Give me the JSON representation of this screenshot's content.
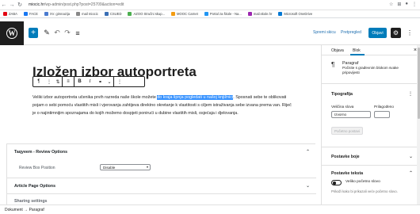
{
  "browser": {
    "url_host": "miocic.hr",
    "url_path": "/wp-admin/post.php?post=25709&action=edit",
    "bookmarks": [
      {
        "label": "ZABA",
        "color": "#e30613"
      },
      {
        "label": "FACE",
        "color": "#1877f2"
      },
      {
        "label": "XV. gimnazija",
        "color": "#4a7bd0"
      },
      {
        "label": "mail miocic",
        "color": "#888888"
      },
      {
        "label": "CSUED",
        "color": "#3a6fb5"
      },
      {
        "label": "AZOO Stručni skup...",
        "color": "#4caf50"
      },
      {
        "label": "MOOC Carnet",
        "color": "#f39c12"
      },
      {
        "label": "Portal za škole - Na...",
        "color": "#2196f3"
      },
      {
        "label": "mail.skole.hr",
        "color": "#9c27b0"
      },
      {
        "label": "Microsoft OneDrive",
        "color": "#0078d4"
      }
    ]
  },
  "topbar": {
    "save_draft": "Spremi skicu",
    "preview": "Pretpregled",
    "publish": "Objavi"
  },
  "editor": {
    "title": "Izložen izbor autoportreta",
    "paragraph_before": "Veliki izbor autoportreta učenika prvih razreda naše škole možete ",
    "paragraph_highlight": "do kraja lipnja pogledati u našoj knjižnici",
    "paragraph_after": ". Sposnati sebe te oblikovati pojam o sebi pomoću vlastitih misli i vjerovanja zahtijeva direktno okretanje k vlastitosti s ciljem istraživanja sebe izvana prema van. Riječ je o najintimnijim spoznajama do kojih možemo dospjeti ponirući u dubine vlastitih misli, osjećaja i djelovanja."
  },
  "metabox": {
    "section1_title": "Taqyeem - Review Options",
    "review_box_position_label": "Review Box Position",
    "review_box_position_value": "Disable",
    "section2_title": "Article Page Options",
    "section3_title": "Sharing settings"
  },
  "sidebar": {
    "tab_post": "Objava",
    "tab_block": "Blok",
    "block_name": "Paragraf",
    "block_desc": "Počnite s građevnim blokom svake pripovijesti",
    "typography_title": "Tipografija",
    "font_size_label": "Veličina slova",
    "font_size_value": "Izvorno",
    "custom_label": "Prilagođeno",
    "reset_label": "Početno postavi",
    "colors_title": "Postavke boje",
    "text_settings_title": "Postavke teksta",
    "drop_cap_label": "Veliko početno slovo",
    "drop_cap_help": "Prikaži kako bi prikazali veće početno slovo."
  },
  "status": {
    "breadcrumb": "Dokument → Paragraf"
  }
}
